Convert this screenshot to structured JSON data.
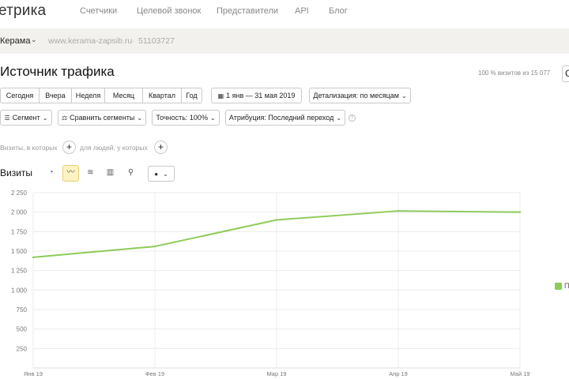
{
  "topnav": {
    "logo": "етрика",
    "links": [
      "Счетчики",
      "Целевой звонок",
      "Представители",
      "API",
      "Блог"
    ]
  },
  "counter": {
    "name": "Керама",
    "chevron": "⌄",
    "url": "www.kerama-zapsib.ru",
    "separator": "·",
    "id": "51103727"
  },
  "page": {
    "title": "Источник трафика",
    "visits_share": "100 % визитов из 15 077",
    "edge_button": "С"
  },
  "periods": [
    "Сегодня",
    "Вчера",
    "Неделя",
    "Месяц",
    "Квартал",
    "Год"
  ],
  "date_range": "1 янв — 31 мая 2019",
  "detail": "Детализация: по месяцам",
  "toolbar2": {
    "segment": "Сегмент",
    "compare": "Сравнить сегменты",
    "accuracy": "Точность: 100%",
    "attribution": "Атрибуция: Последний переход"
  },
  "filters": {
    "visits_where": "Визиты, в которых",
    "people_where": "для людей, у которых"
  },
  "chart_toolbar": {
    "label": "Визиты",
    "icons": [
      "pie-chart-icon",
      "line-chart-icon",
      "area-chart-icon",
      "bar-chart-icon",
      "map-pin-icon",
      "comment-icon"
    ]
  },
  "legend": {
    "label": "П",
    "color": "#8ecb5a"
  },
  "chart_data": {
    "type": "line",
    "categories": [
      "Янв 19",
      "Фев 19",
      "Мар 19",
      "Апр 19",
      "Май 19"
    ],
    "series": [
      {
        "values": [
          1420,
          1560,
          1900,
          2015,
          2000
        ],
        "color": "#8ecb5a"
      }
    ],
    "yticks": [
      "2 250",
      "2 000",
      "1 750",
      "1 500",
      "1 250",
      "1 000",
      "750",
      "500",
      "250"
    ],
    "ylim": [
      0,
      2250
    ],
    "grid": true
  }
}
